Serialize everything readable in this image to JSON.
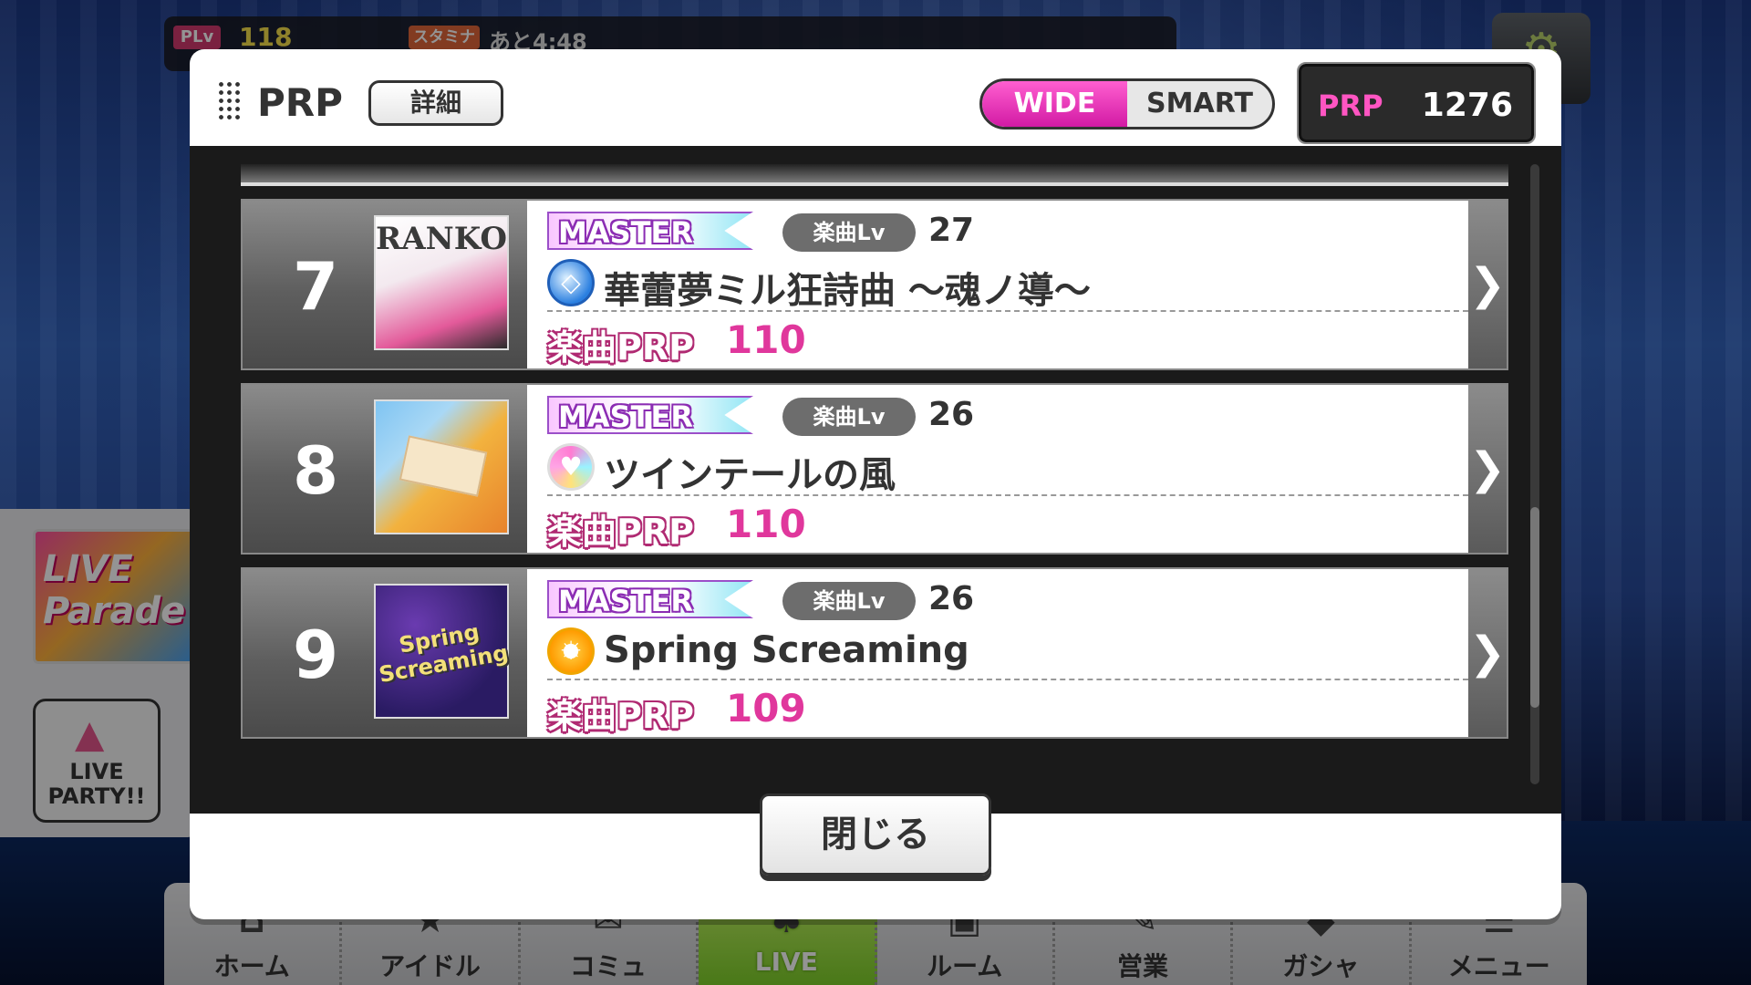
{
  "hud": {
    "plv_label": "PLv",
    "plv_value": "118",
    "stamina_label": "スタミナ",
    "stamina_time": "あと4:48"
  },
  "side": {
    "banner_text": "LIVE Parade",
    "party_label": "LIVE PARTY!!"
  },
  "nav": {
    "items": [
      {
        "label": "ホーム",
        "icon": "home-icon"
      },
      {
        "label": "アイドル",
        "icon": "idol-icon"
      },
      {
        "label": "コミュ",
        "icon": "commu-icon"
      },
      {
        "label": "LIVE",
        "icon": "live-icon"
      },
      {
        "label": "ルーム",
        "icon": "room-icon"
      },
      {
        "label": "営業",
        "icon": "business-icon"
      },
      {
        "label": "ガシャ",
        "icon": "gacha-icon"
      },
      {
        "label": "メニュー",
        "icon": "menu-icon"
      }
    ],
    "active_index": 3
  },
  "dialog": {
    "title": "PRP",
    "detail_label": "詳細",
    "toggle": {
      "wide": "WIDE",
      "smart": "SMART",
      "selected": "WIDE"
    },
    "prp_total_label": "PRP",
    "prp_total_value": "1276",
    "close_label": "閉じる"
  },
  "songs": [
    {
      "rank": "7",
      "difficulty": "MASTER",
      "lv_label": "楽曲Lv",
      "lv": "27",
      "type": "cool",
      "type_icon": "diamond-icon",
      "title": "華蕾夢ミル狂詩曲 ～魂ノ導～",
      "prp_label": "楽曲PRP",
      "prp": "110",
      "jacket_text": "RANKO",
      "jacket_colors": [
        "#f6f1f4",
        "#e85a9e"
      ]
    },
    {
      "rank": "8",
      "difficulty": "MASTER",
      "lv_label": "楽曲Lv",
      "lv": "26",
      "type": "cute",
      "type_icon": "heart-icon",
      "title": "ツインテールの風",
      "prp_label": "楽曲PRP",
      "prp": "110",
      "jacket_text": "",
      "jacket_colors": [
        "#6fb6f0",
        "#f2a53a"
      ]
    },
    {
      "rank": "9",
      "difficulty": "MASTER",
      "lv_label": "楽曲Lv",
      "lv": "26",
      "type": "passion",
      "type_icon": "sun-icon",
      "title": "Spring Screaming",
      "prp_label": "楽曲PRP",
      "prp": "109",
      "jacket_text": "Spring Screaming",
      "jacket_colors": [
        "#2a1b63",
        "#6a3bb0"
      ]
    }
  ]
}
